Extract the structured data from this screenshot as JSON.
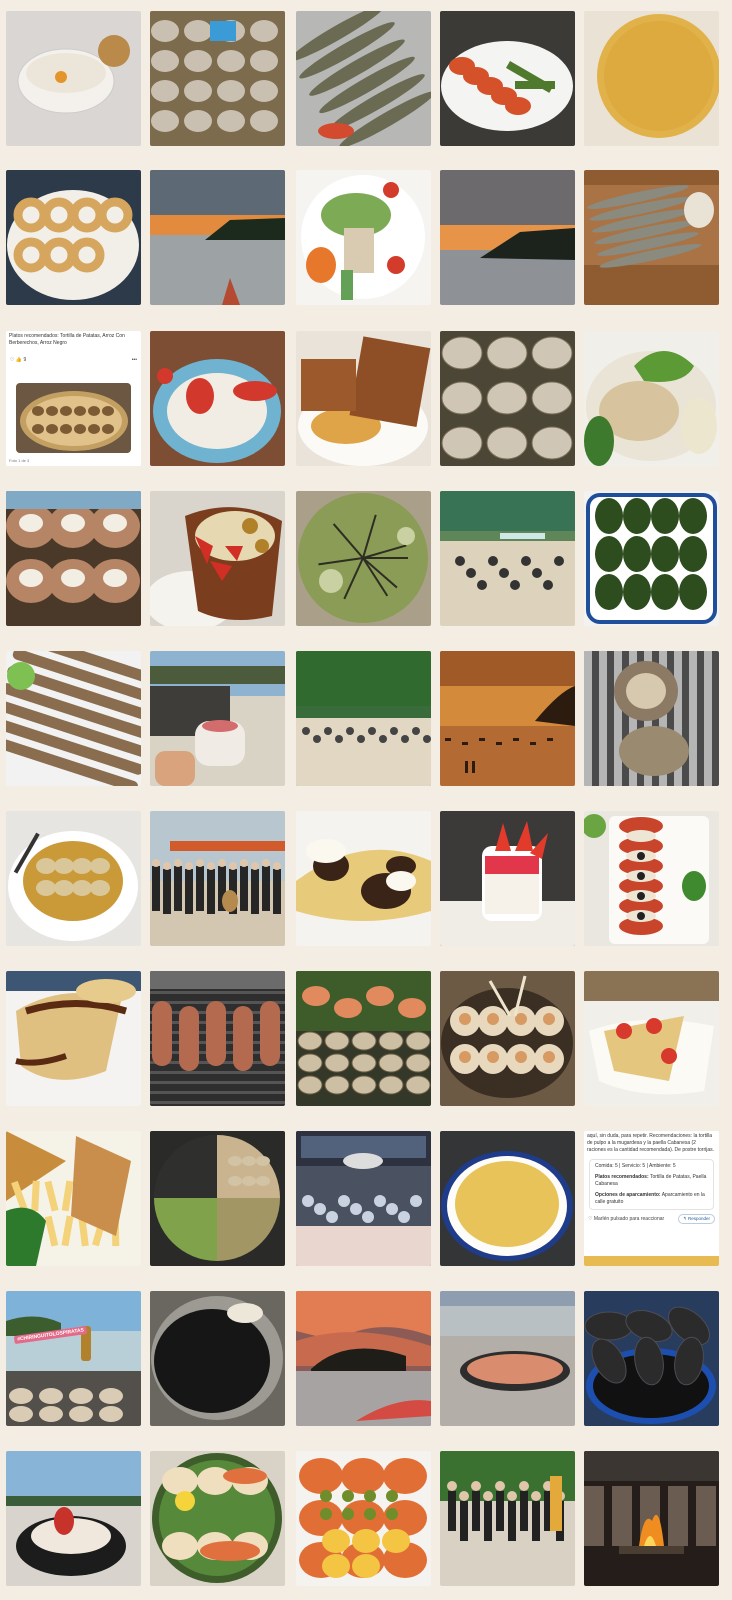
{
  "gallery": {
    "tiles": [
      {
        "name": "tile-almond-soup"
      },
      {
        "name": "tile-clams-dish"
      },
      {
        "name": "tile-grilled-sardines"
      },
      {
        "name": "tile-grilled-vegetables"
      },
      {
        "name": "tile-potato-tortilla"
      },
      {
        "name": "tile-fried-calamari"
      },
      {
        "name": "tile-sunset-beach"
      },
      {
        "name": "tile-mixed-salad"
      },
      {
        "name": "tile-sunset-bay"
      },
      {
        "name": "tile-sardines-tray"
      },
      {
        "name": "tile-review-screenshot-clams"
      },
      {
        "name": "tile-strawberry-dessert"
      },
      {
        "name": "tile-toast-dessert"
      },
      {
        "name": "tile-steamed-clams"
      },
      {
        "name": "tile-fish-with-pepper"
      },
      {
        "name": "tile-scallops"
      },
      {
        "name": "tile-strawberry-cup"
      },
      {
        "name": "tile-green-rice"
      },
      {
        "name": "tile-beach-party"
      },
      {
        "name": "tile-padron-peppers"
      },
      {
        "name": "tile-razor-clams"
      },
      {
        "name": "tile-beach-bar-drink"
      },
      {
        "name": "tile-beach-terrace"
      },
      {
        "name": "tile-sunset-boats"
      },
      {
        "name": "tile-grilled-fish-rack"
      },
      {
        "name": "tile-clams-in-sauce"
      },
      {
        "name": "tile-musicians-group"
      },
      {
        "name": "tile-crepes-figs"
      },
      {
        "name": "tile-panna-cotta"
      },
      {
        "name": "tile-tomato-salad"
      },
      {
        "name": "tile-chocolate-crepes"
      },
      {
        "name": "tile-grilled-sausages"
      },
      {
        "name": "tile-seafood-platter"
      },
      {
        "name": "tile-octopus"
      },
      {
        "name": "tile-strawberry-crepe"
      },
      {
        "name": "tile-fish-and-chips"
      },
      {
        "name": "tile-mixed-paella"
      },
      {
        "name": "tile-restaurant-diners"
      },
      {
        "name": "tile-tortilla-plate"
      },
      {
        "name": "tile-review-screenshot-text"
      },
      {
        "name": "tile-beach-beer"
      },
      {
        "name": "tile-black-rice"
      },
      {
        "name": "tile-dramatic-sunset"
      },
      {
        "name": "tile-paella-on-beach"
      },
      {
        "name": "tile-mussels"
      },
      {
        "name": "tile-beach-dessert-pot"
      },
      {
        "name": "tile-seafood-green-rice"
      },
      {
        "name": "tile-tomato-olives"
      },
      {
        "name": "tile-beach-group"
      },
      {
        "name": "tile-night-grill"
      }
    ],
    "sticker_text": "#CHIRINGUITOLOSPIRATAS"
  },
  "review_clams": {
    "text": "Platos recomendados: Tortilla de Patatas, Arroz Con Berberechos, Arroz Negro",
    "likes": "9",
    "menu": "•••",
    "footer": "Foto 1 de 3"
  },
  "review_text": {
    "intro": "aquí, sin duda, para repetir. Recomendaciones: la tortilla de pulpo a la mugardesa y la paella Cabanesa (2 raciones es la cantidad recomendada). De postre torrijas.",
    "ratings": "Comida: 5 | Servicio: 5 | Ambiente: 5",
    "dishes_label": "Platos recomendados:",
    "dishes": "Tortilla de Patatas, Paella Cabanesa",
    "parking_label": "Opciones de aparcamiento:",
    "parking": "Aparcamiento en la calle gratuito",
    "like_text": "Marlén pulsado para reaccionar",
    "reply_button": "Responder"
  }
}
